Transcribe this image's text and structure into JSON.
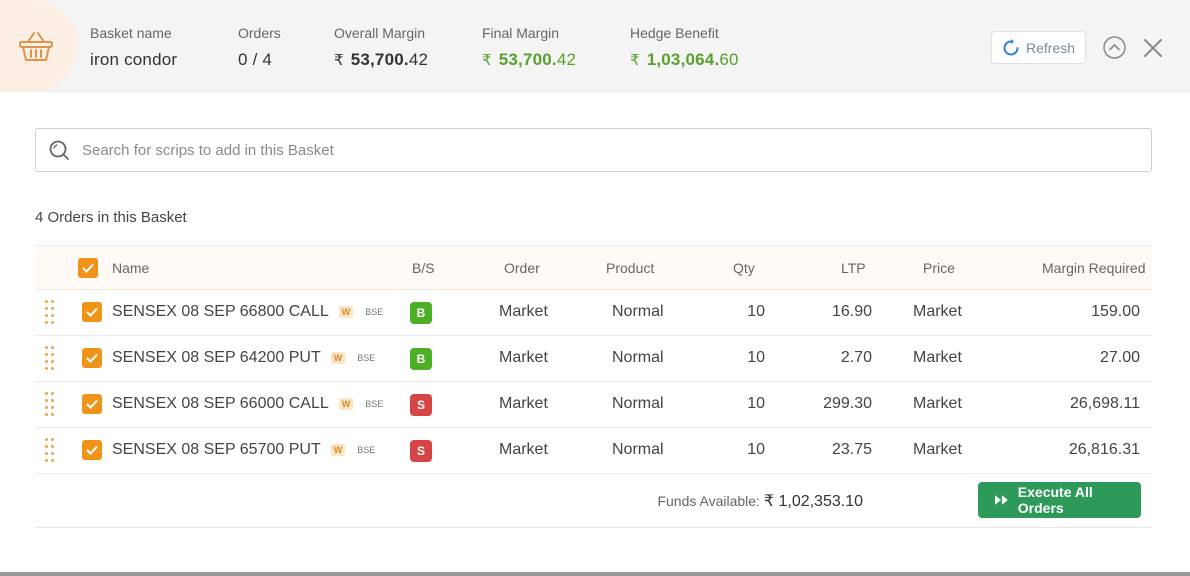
{
  "header": {
    "basket_name_label": "Basket name",
    "basket_name": "iron condor",
    "orders_label": "Orders",
    "orders_value": "0 / 4",
    "overall_margin_label": "Overall Margin",
    "overall_margin_int": "53,700.",
    "overall_margin_dec": "42",
    "final_margin_label": "Final Margin",
    "final_margin_int": "53,700.",
    "final_margin_dec": "42",
    "hedge_benefit_label": "Hedge Benefit",
    "hedge_benefit_int": "1,03,064.",
    "hedge_benefit_dec": "60",
    "currency": "₹",
    "refresh_label": "Refresh"
  },
  "search": {
    "placeholder": "Search for scrips to add in this Basket"
  },
  "orders_count_label": "4 Orders in this Basket",
  "table": {
    "headers": {
      "name": "Name",
      "bs": "B/S",
      "order": "Order",
      "product": "Product",
      "qty": "Qty",
      "ltp": "LTP",
      "price": "Price",
      "margin": "Margin Required"
    },
    "rows": [
      {
        "name": "SENSEX 08 SEP 66800 CALL",
        "badge": "W",
        "exchange": "BSE",
        "bs": "B",
        "order": "Market",
        "product": "Normal",
        "qty": "10",
        "ltp": "16.90",
        "price": "Market",
        "margin": "159.00"
      },
      {
        "name": "SENSEX 08 SEP 64200 PUT",
        "badge": "W",
        "exchange": "BSE",
        "bs": "B",
        "order": "Market",
        "product": "Normal",
        "qty": "10",
        "ltp": "2.70",
        "price": "Market",
        "margin": "27.00"
      },
      {
        "name": "SENSEX 08 SEP 66000 CALL",
        "badge": "W",
        "exchange": "BSE",
        "bs": "S",
        "order": "Market",
        "product": "Normal",
        "qty": "10",
        "ltp": "299.30",
        "price": "Market",
        "margin": "26,698.11"
      },
      {
        "name": "SENSEX 08 SEP 65700 PUT",
        "badge": "W",
        "exchange": "BSE",
        "bs": "S",
        "order": "Market",
        "product": "Normal",
        "qty": "10",
        "ltp": "23.75",
        "price": "Market",
        "margin": "26,816.31"
      }
    ]
  },
  "footer": {
    "funds_label": "Funds Available:",
    "funds_value": "₹ 1,02,353.10",
    "execute_label": "Execute All Orders"
  },
  "colors": {
    "accent": "#ef9418",
    "buy": "#4caf26",
    "sell": "#d64545",
    "positive": "#5aa02c",
    "execute": "#2e9a5a"
  }
}
